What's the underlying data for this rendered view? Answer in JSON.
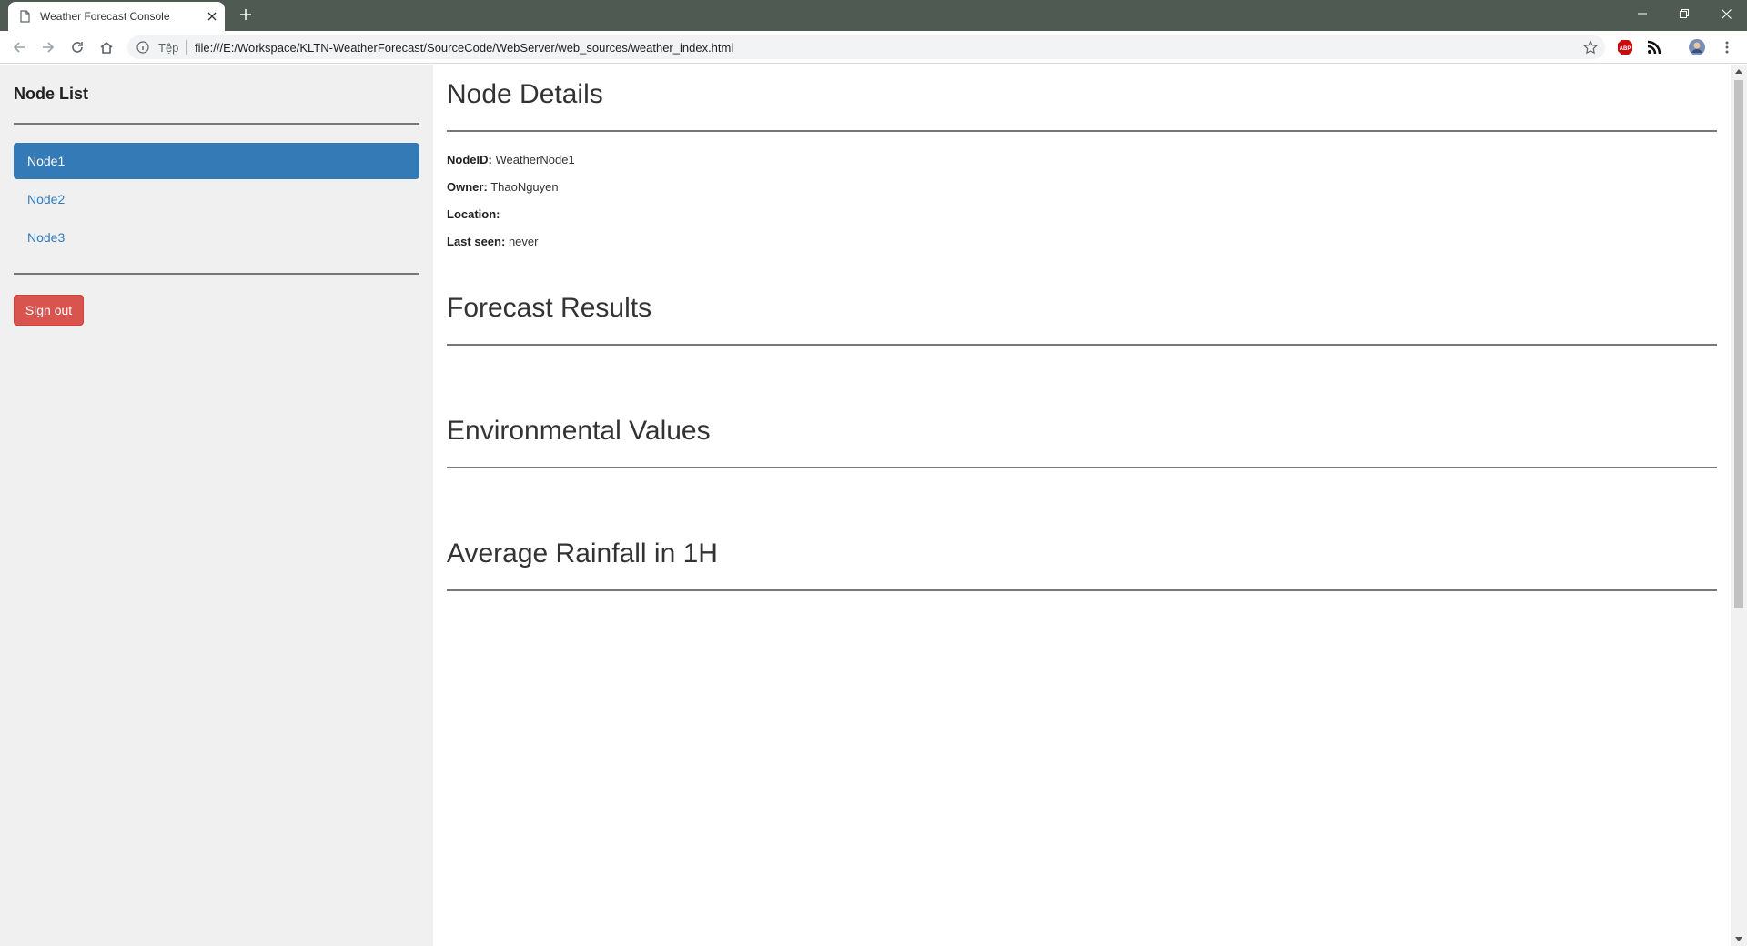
{
  "browser": {
    "tab_title": "Weather Forecast Console",
    "scheme_label": "Tệp",
    "url": "file:///E:/Workspace/KLTN-WeatherForecast/SourceCode/WebServer/web_sources/weather_index.html",
    "extensions": [
      "abp-icon",
      "rss-icon",
      "profile-avatar"
    ]
  },
  "sidebar": {
    "title": "Node List",
    "items": [
      {
        "label": "Node1",
        "active": true
      },
      {
        "label": "Node2",
        "active": false
      },
      {
        "label": "Node3",
        "active": false
      }
    ],
    "signout_label": "Sign out"
  },
  "main": {
    "node_details_title": "Node Details",
    "details": {
      "nodeid_label": "NodeID:",
      "nodeid_value": "WeatherNode1",
      "owner_label": "Owner:",
      "owner_value": "ThaoNguyen",
      "location_label": "Location:",
      "location_value": "",
      "lastseen_label": "Last seen:",
      "lastseen_value": "never"
    },
    "forecast_title": "Forecast Results",
    "environmental_title": "Environmental Values",
    "rainfall_title": "Average Rainfall in 1H"
  },
  "colors": {
    "titlebar": "#4f5b52",
    "active_nav": "#337ab7",
    "signout": "#d9534f",
    "sidebar_bg": "#f0f0f0"
  }
}
